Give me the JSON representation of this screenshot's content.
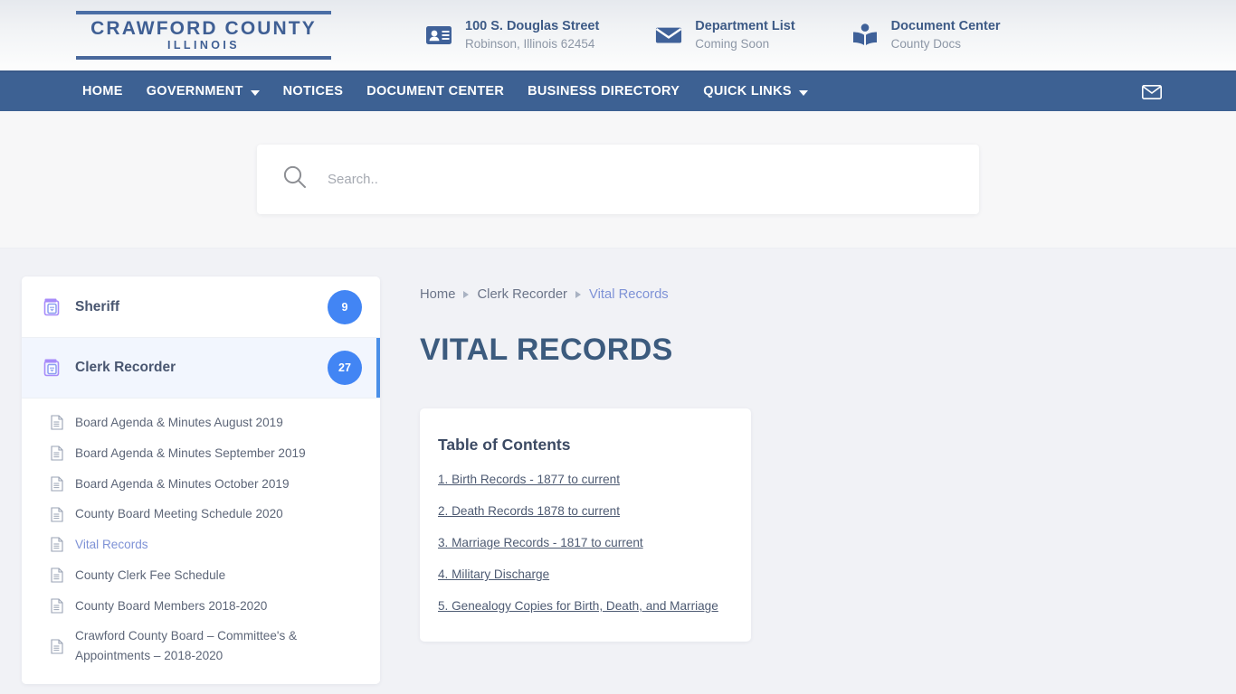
{
  "header": {
    "logo": {
      "main": "CRAWFORD COUNTY",
      "sub": "ILLINOIS"
    },
    "contacts": [
      {
        "icon": "id-card-icon",
        "title": "100 S. Douglas Street",
        "sub": "Robinson, Illinois 62454"
      },
      {
        "icon": "envelope-icon",
        "title": "Department List",
        "sub": "Coming Soon"
      },
      {
        "icon": "open-book-icon",
        "title": "Document Center",
        "sub": "County Docs"
      }
    ]
  },
  "nav": {
    "items": [
      {
        "label": "HOME",
        "caret": false
      },
      {
        "label": "GOVERNMENT",
        "caret": true
      },
      {
        "label": "NOTICES",
        "caret": false
      },
      {
        "label": "DOCUMENT CENTER",
        "caret": false
      },
      {
        "label": "BUSINESS DIRECTORY",
        "caret": false
      },
      {
        "label": "QUICK LINKS",
        "caret": true
      }
    ],
    "mail_icon": "mail-icon"
  },
  "search": {
    "placeholder": "Search..",
    "value": "",
    "icon": "search-icon"
  },
  "sidebar": {
    "categories": [
      {
        "label": "Sheriff",
        "badge": "9",
        "active": false
      },
      {
        "label": "Clerk Recorder",
        "badge": "27",
        "active": true
      }
    ],
    "documents": [
      {
        "label": "Board Agenda & Minutes August 2019",
        "current": false
      },
      {
        "label": "Board Agenda & Minutes September 2019",
        "current": false
      },
      {
        "label": "Board Agenda & Minutes October 2019",
        "current": false
      },
      {
        "label": "County Board Meeting Schedule 2020",
        "current": false
      },
      {
        "label": "Vital Records",
        "current": true
      },
      {
        "label": "County Clerk Fee Schedule",
        "current": false
      },
      {
        "label": "County Board Members 2018-2020",
        "current": false
      },
      {
        "label": "Crawford County Board – Committee's & Appointments – 2018-2020",
        "current": false
      }
    ]
  },
  "main": {
    "breadcrumb": [
      {
        "label": "Home",
        "current": false
      },
      {
        "label": "Clerk Recorder",
        "current": false
      },
      {
        "label": "Vital Records",
        "current": true
      }
    ],
    "title": "VITAL RECORDS",
    "toc": {
      "title": "Table of Contents",
      "links": [
        "1. Birth Records - 1877 to current",
        "2. Death Records 1878 to current",
        "3. Marriage Records - 1817 to current",
        "4. Military Discharge",
        "5. Genealogy Copies for Birth, Death, and Marriage"
      ]
    }
  },
  "colors": {
    "nav_blue": "#3d6193",
    "logo_blue": "#3f5f94",
    "badge_blue": "#4285f4",
    "accent_bar": "#4a8fe8",
    "link_violet": "#7e92d6",
    "page_bg": "#f1f2f6"
  }
}
